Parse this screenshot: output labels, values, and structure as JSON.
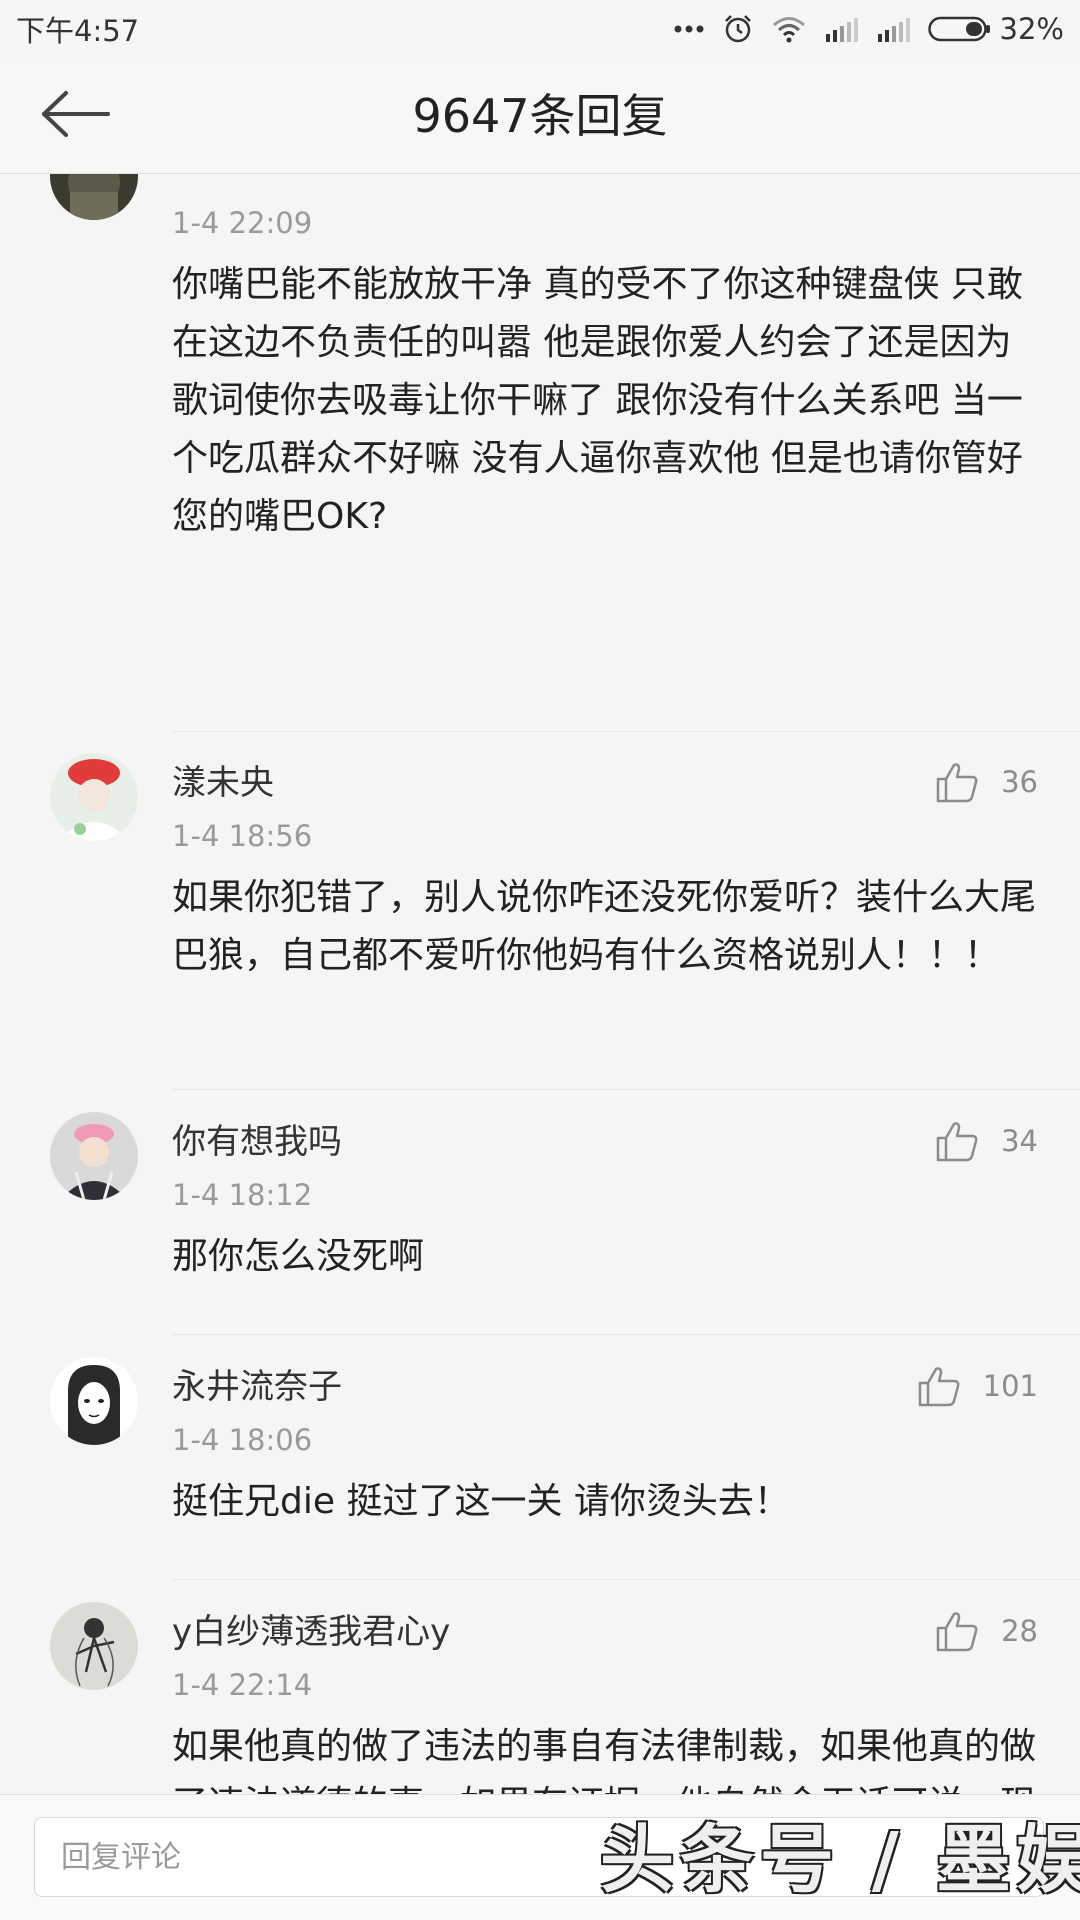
{
  "status_bar": {
    "time": "下午4:57",
    "battery_percent": "32%",
    "icons": [
      "more-dots-icon",
      "alarm-icon",
      "wifi-icon",
      "signal-icon",
      "signal-icon",
      "battery-icon"
    ]
  },
  "header": {
    "title": "9647条回复",
    "back_icon": "back-arrow-icon"
  },
  "comments": [
    {
      "username": "",
      "time": "1-4 22:09",
      "body": "你嘴巴能不能放放干净 真的受不了你这种键盘侠 只敢在这边不负责任的叫嚣 他是跟你爱人约会了还是因为歌词使你去吸毒让你干嘛了 跟你没有什么关系吧 当一个吃瓜群众不好嘛 没有人逼你喜欢他 但是也请你管好您的嘴巴OK?",
      "likes": ""
    },
    {
      "username": "漾未央",
      "time": "1-4 18:56",
      "body": "如果你犯错了，别人说你咋还没死你爱听？装什么大尾巴狼，自己都不爱听你他妈有什么资格说别人！！！",
      "likes": "36"
    },
    {
      "username": "你有想我吗",
      "time": "1-4 18:12",
      "body": "那你怎么没死啊",
      "likes": "34"
    },
    {
      "username": "永井流奈子",
      "time": "1-4 18:06",
      "body": "挺住兄die 挺过了这一关 请你烫头去！",
      "likes": "101"
    },
    {
      "username": "y白纱薄透我君心y",
      "time": "1-4 22:14",
      "body": "如果他真的做了违法的事自有法律制裁，如果他真的做了违法道德的事，如果有证据，他自然会无话可说。现在什么实质的证据都没有，就胡说八道，毁了他你就这么开心？",
      "likes": "28"
    }
  ],
  "reply_bar": {
    "placeholder": "回复评论"
  },
  "watermark": {
    "text": "头条号 / 墨娱"
  },
  "colors": {
    "background": "#f5f5f5",
    "text": "#222222",
    "muted": "#9a9a9a"
  }
}
